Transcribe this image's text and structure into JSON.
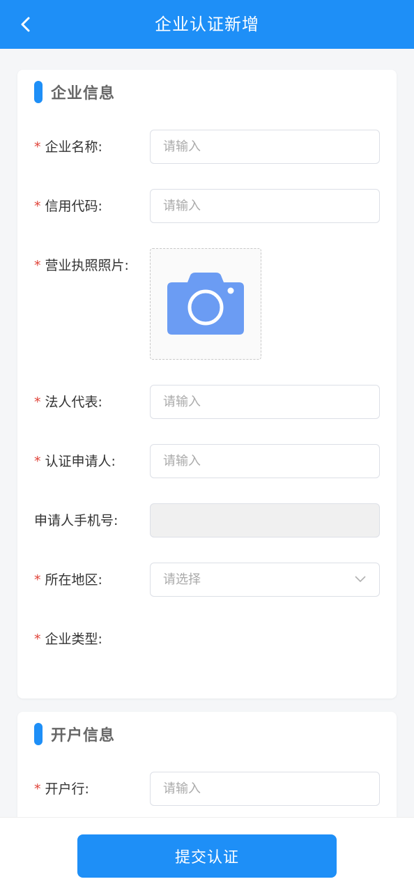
{
  "header": {
    "title": "企业认证新增",
    "back_icon": "chevron-left-icon"
  },
  "colors": {
    "primary": "#1e8ff7",
    "required": "#e0443a",
    "camera": "#6b9cf3"
  },
  "sections": {
    "company_info": {
      "title": "企业信息",
      "fields": {
        "company_name": {
          "label": "企业名称:",
          "placeholder": "请输入",
          "required": true
        },
        "credit_code": {
          "label": "信用代码:",
          "placeholder": "请输入",
          "required": true
        },
        "license_photo": {
          "label": "营业执照照片:",
          "required": true,
          "icon": "camera-icon"
        },
        "legal_rep": {
          "label": "法人代表:",
          "placeholder": "请输入",
          "required": true
        },
        "applicant": {
          "label": "认证申请人:",
          "placeholder": "请输入",
          "required": true
        },
        "applicant_phone": {
          "label": "申请人手机号:",
          "value": "",
          "required": false,
          "disabled": true
        },
        "region": {
          "label": "所在地区:",
          "placeholder": "请选择",
          "required": true
        },
        "company_type": {
          "label": "企业类型:",
          "required": true
        }
      }
    },
    "account_info": {
      "title": "开户信息",
      "fields": {
        "bank": {
          "label": "开户行:",
          "placeholder": "请输入",
          "required": true
        }
      }
    }
  },
  "footer": {
    "submit_label": "提交认证"
  },
  "required_mark": "*"
}
